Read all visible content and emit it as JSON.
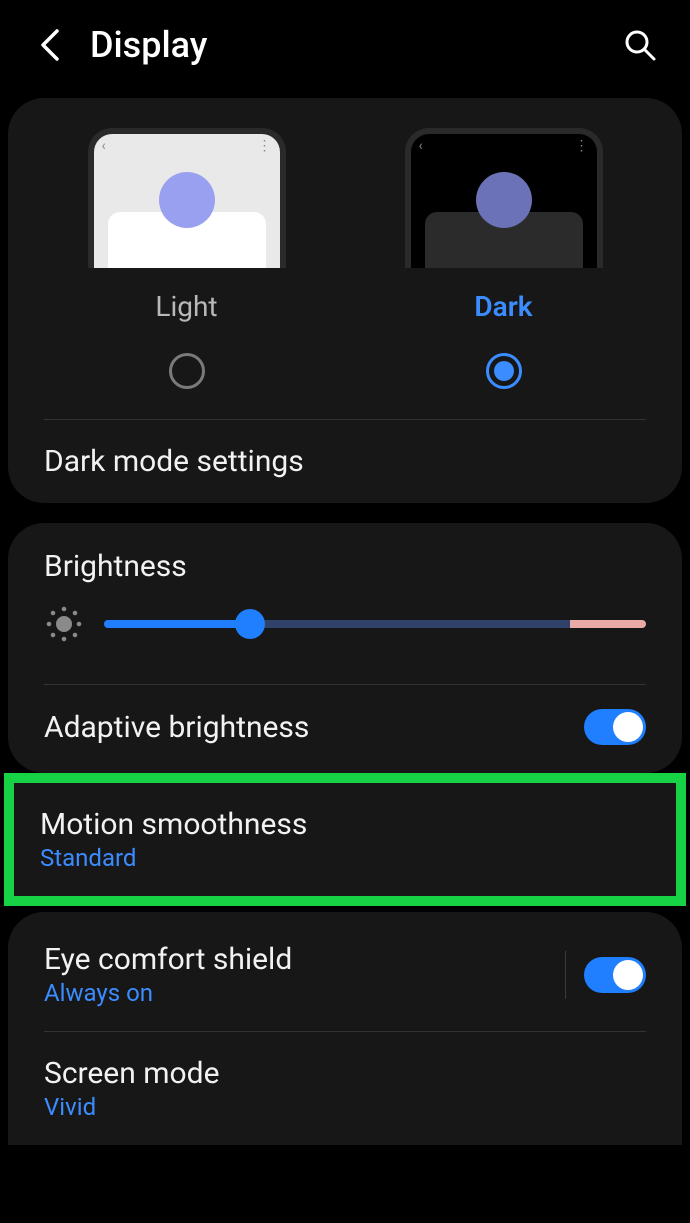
{
  "header": {
    "title": "Display"
  },
  "theme": {
    "light_label": "Light",
    "dark_label": "Dark",
    "selected": "dark"
  },
  "dark_mode_settings": {
    "label": "Dark mode settings"
  },
  "brightness": {
    "label": "Brightness",
    "value_percent": 27,
    "warn_percent": 14
  },
  "adaptive_brightness": {
    "label": "Adaptive brightness",
    "enabled": true
  },
  "motion_smoothness": {
    "label": "Motion smoothness",
    "value": "Standard"
  },
  "eye_comfort": {
    "label": "Eye comfort shield",
    "value": "Always on",
    "enabled": true
  },
  "screen_mode": {
    "label": "Screen mode",
    "value": "Vivid"
  }
}
